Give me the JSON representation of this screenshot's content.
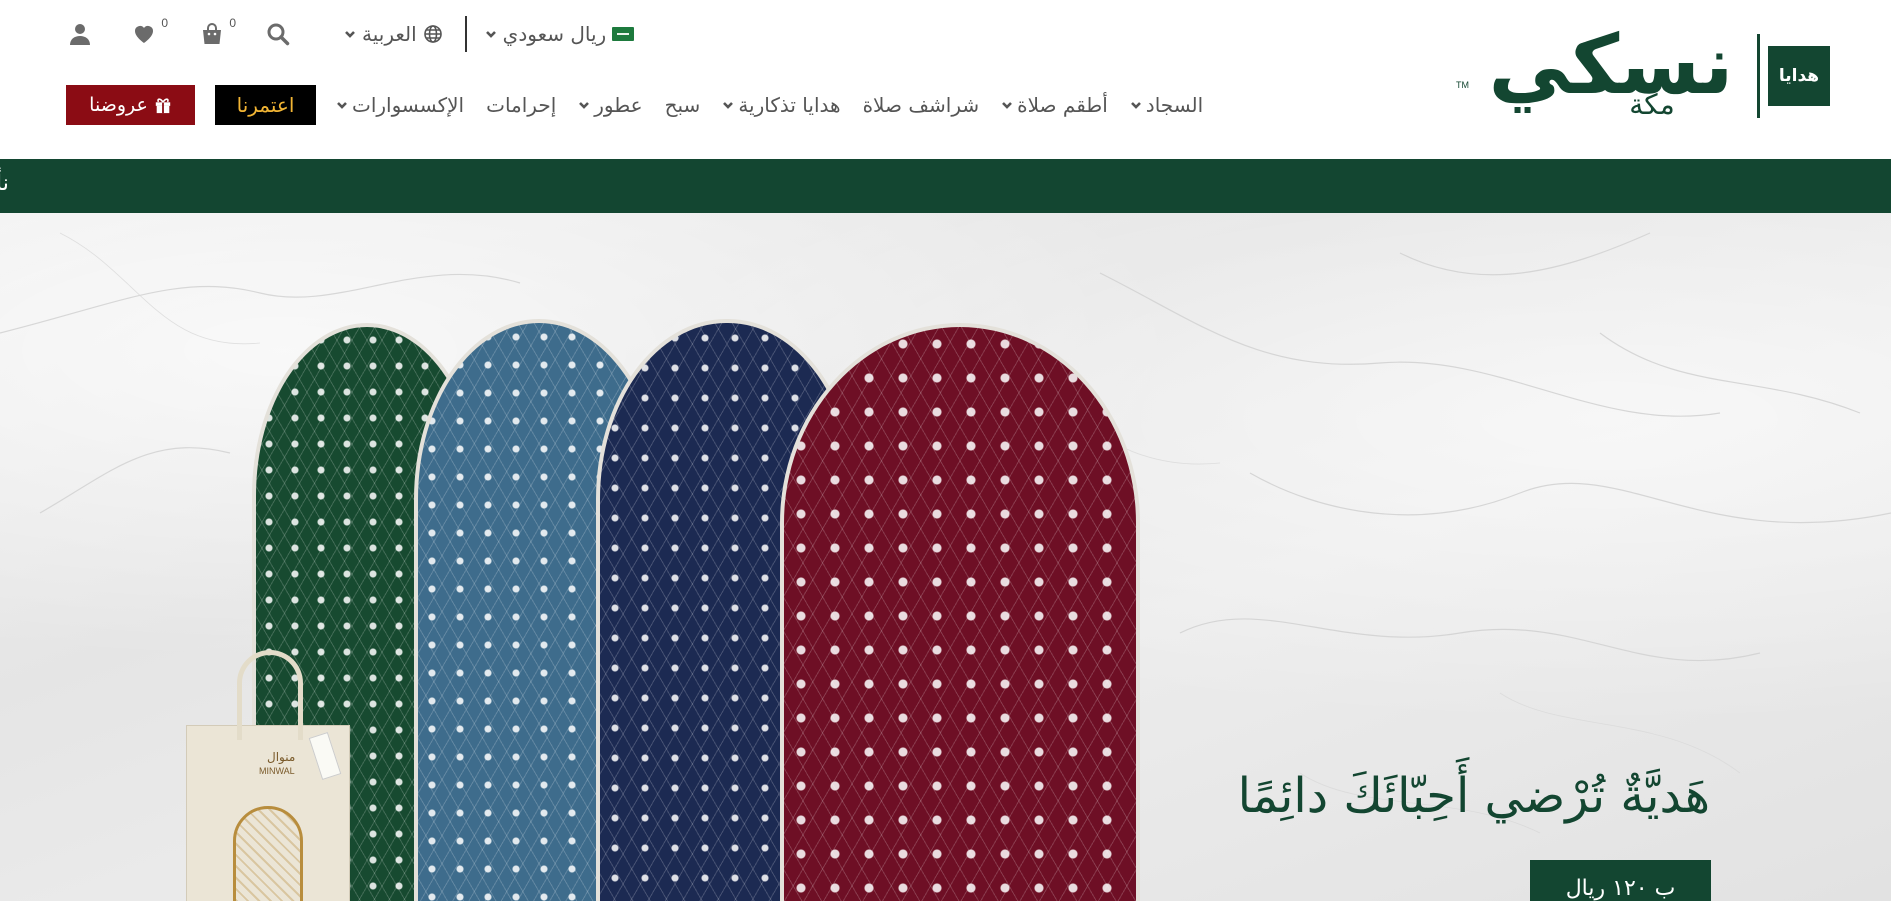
{
  "header": {
    "language_label": "العربية",
    "currency_label": "ريال سعودي",
    "cart_count": "0",
    "wishlist_count": "0"
  },
  "logo": {
    "badge_text": "هدايا",
    "wordmark": "نسكي",
    "sub_text": "مكة",
    "tm": "TM"
  },
  "nav": {
    "items": [
      {
        "label": "السجاد",
        "has_dropdown": true
      },
      {
        "label": "أطقم صلاة",
        "has_dropdown": true
      },
      {
        "label": "شراشف صلاة",
        "has_dropdown": false
      },
      {
        "label": "هدايا تذكارية",
        "has_dropdown": true
      },
      {
        "label": "سبح",
        "has_dropdown": false
      },
      {
        "label": "عطور",
        "has_dropdown": true
      },
      {
        "label": "إحرامات",
        "has_dropdown": false
      },
      {
        "label": "الإكسسوارات",
        "has_dropdown": true
      }
    ],
    "umrah_button": "اعتمرنا",
    "offers_button": "عروضنا"
  },
  "announcement": {
    "text": "نأ"
  },
  "hero": {
    "headline": "هَديَّةٌ تُرْضي أَحِبّائَكَ دائِمًا",
    "cta_label": "ب ١٢٠ ريال",
    "bag_brand": "MINWAL",
    "bag_brand_ar": "منوال"
  },
  "colors": {
    "brand_green": "#134631",
    "offers_red": "#8b0c14",
    "umrah_black": "#000000",
    "umrah_text": "#f2b534"
  },
  "icons": [
    "user-icon",
    "heart-icon",
    "shopping-bag-icon",
    "search-icon",
    "globe-icon",
    "chevron-down-icon",
    "gift-icon",
    "saudi-flag-icon"
  ]
}
